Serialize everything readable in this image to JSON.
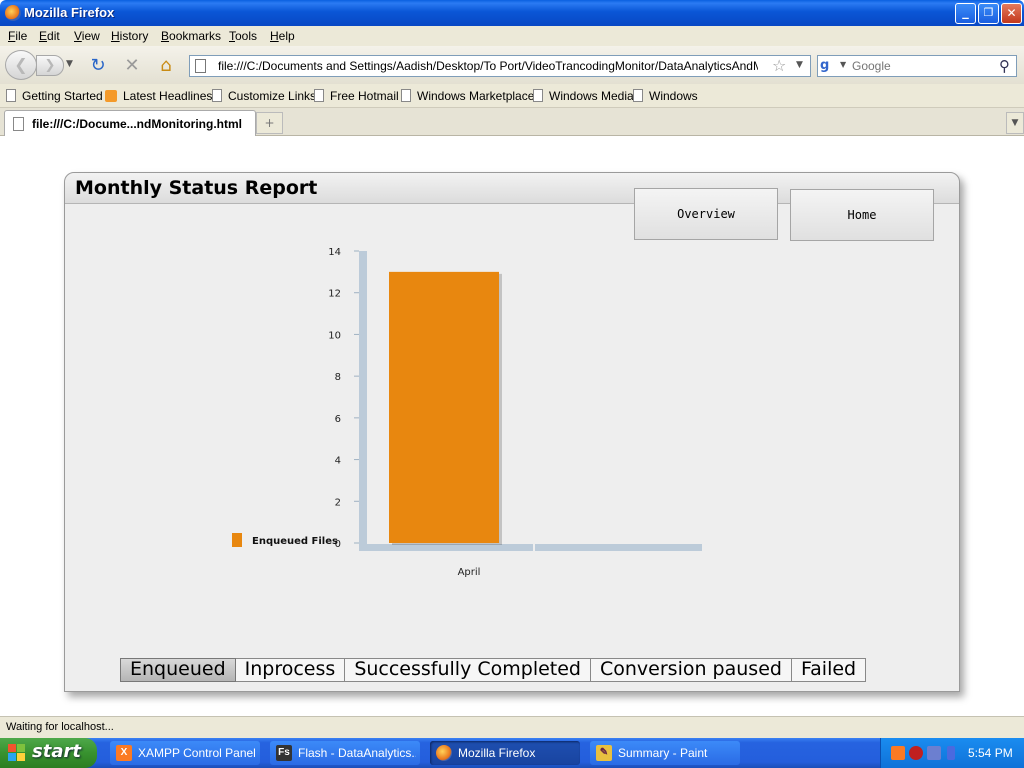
{
  "window": {
    "title": "Mozilla Firefox",
    "buttons": {
      "minimize": "_",
      "restore": "❐",
      "close": "✕"
    }
  },
  "menu": [
    "File",
    "Edit",
    "View",
    "History",
    "Bookmarks",
    "Tools",
    "Help"
  ],
  "toolbar": {
    "url": "file:///C:/Documents and Settings/Aadish/Desktop/To Port/VideoTrancodingMonitor/DataAnalyticsAndMonitoring_M",
    "search_placeholder": "Google",
    "icons": [
      "back-icon",
      "forward-icon",
      "reload-icon",
      "stop-icon",
      "home-icon",
      "bookmark-star-icon",
      "search-icon"
    ]
  },
  "bookmarks": [
    {
      "label": "Getting Started",
      "icon": "page-icon"
    },
    {
      "label": "Latest Headlines",
      "icon": "rss-icon"
    },
    {
      "label": "Customize Links",
      "icon": "page-icon"
    },
    {
      "label": "Free Hotmail",
      "icon": "page-icon"
    },
    {
      "label": "Windows Marketplace",
      "icon": "page-icon"
    },
    {
      "label": "Windows Media",
      "icon": "page-icon"
    },
    {
      "label": "Windows",
      "icon": "page-icon"
    }
  ],
  "tab": {
    "label": "file:///C:/Docume...ndMonitoring.html",
    "new_tab": "+"
  },
  "report": {
    "title": "Monthly Status Report",
    "nav_buttons": [
      "Overview",
      "Home"
    ],
    "bottom_tabs": [
      "Enqueued",
      "Inprocess",
      "Successfully Completed",
      "Conversion paused",
      "Failed"
    ],
    "active_tab": 0
  },
  "chart_data": {
    "type": "bar",
    "categories": [
      "April"
    ],
    "series": [
      {
        "name": "Enqueued Files",
        "values": [
          13
        ],
        "color": "#e8870f"
      }
    ],
    "yticks": [
      0,
      2,
      4,
      6,
      8,
      10,
      12,
      14
    ],
    "ylim": [
      0,
      14
    ],
    "legend": "left",
    "grid": false
  },
  "status": "Waiting for localhost...",
  "taskbar": {
    "start": "start",
    "tasks": [
      {
        "label": "XAMPP Control Panel ...",
        "icon": "xampp-icon",
        "active": false
      },
      {
        "label": "Flash - DataAnalytics...",
        "icon": "flash-icon",
        "active": false
      },
      {
        "label": "Mozilla Firefox",
        "icon": "firefox-icon",
        "active": true
      },
      {
        "label": "Summary - Paint",
        "icon": "paint-icon",
        "active": false
      }
    ],
    "clock": "5:54 PM"
  },
  "colors": {
    "bar": "#e8870f",
    "axis": "#bccbd9",
    "titlebar": "#0a56d6",
    "taskbar": "#245edc"
  }
}
